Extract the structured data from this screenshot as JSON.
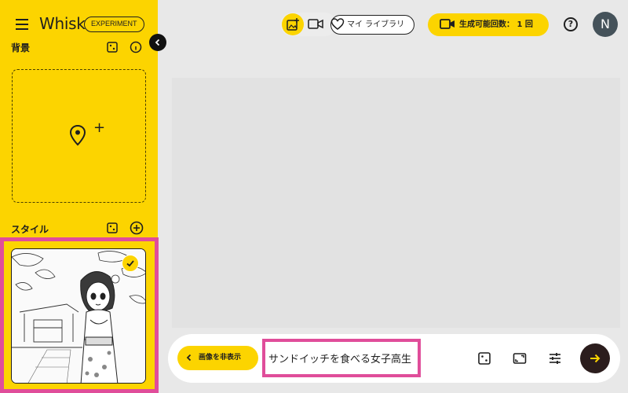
{
  "app": {
    "logo": "Whisk",
    "badge": "EXPERIMENT"
  },
  "sidebar": {
    "scene_title": "背景",
    "style_title": "スタイル"
  },
  "header": {
    "library_label": "マイ ライブラリ",
    "generations_label": "生成可能回数： 1 回",
    "help_label": "?",
    "avatar_initial": "N"
  },
  "bottom": {
    "hide_images_label": "画像を非表示",
    "prompt_value": "サンドイッチを食べる女子高生"
  },
  "colors": {
    "accent_yellow": "#fcd400",
    "highlight_pink": "#e04d9a",
    "submit_dark": "#2b1d1d",
    "avatar_bg": "#45525a"
  }
}
